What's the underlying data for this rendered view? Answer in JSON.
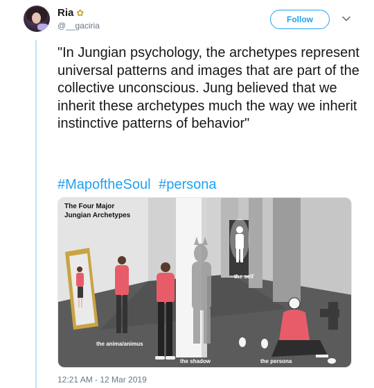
{
  "user": {
    "display_name": "Ria",
    "handle": "@__gaciria",
    "name_emoji": "flower-icon"
  },
  "follow_label": "Follow",
  "tweet": {
    "text": "\"In Jungian psychology, the archetypes represent universal patterns and images that are part of the collective unconscious. Jung believed that we inherit these archetypes much the way we inherit instinctive patterns of behavior\"",
    "hashtags": [
      "#MapoftheSoul",
      "#persona"
    ]
  },
  "media": {
    "title_line1": "The Four Major",
    "title_line2": "Jungian Archetypes",
    "labels": {
      "anima": "the anima/animus",
      "shadow": "the shadow",
      "self": "the self",
      "persona": "the persona"
    }
  },
  "timestamp": "12:21 AM - 12 Mar 2019",
  "colors": {
    "accent": "#1da1f2",
    "thread_line": "#bde0f5",
    "figure": "#e85c6a"
  }
}
